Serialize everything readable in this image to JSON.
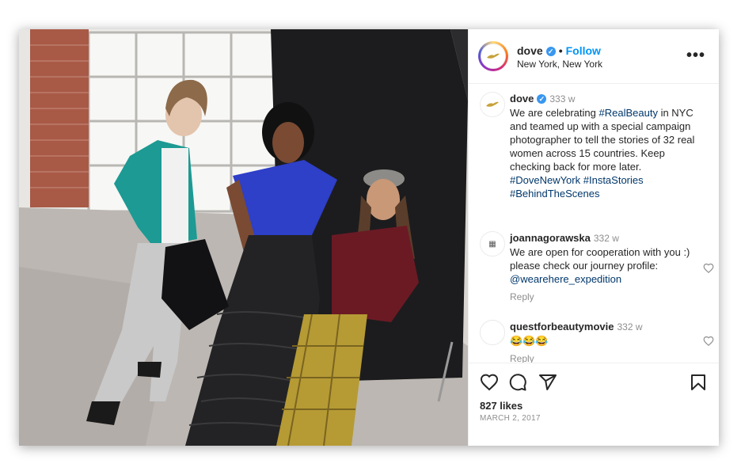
{
  "post": {
    "username": "dove",
    "follow_label": "Follow",
    "separator": "•",
    "location": "New York, New York",
    "more_label": "•••"
  },
  "caption": {
    "username": "dove",
    "time": "333 w",
    "text_1": "We are celebrating ",
    "hashtag_1": "#RealBeauty",
    "text_2": " in NYC and teamed up with a special campaign photographer to tell the stories of 32 real women across 15 countries. Keep checking back for more later. ",
    "hashtag_2": "#DoveNewYork",
    "hashtag_3": "#InstaStories",
    "hashtag_4": "#BehindTheScenes"
  },
  "comments": [
    {
      "username": "joannagorawska",
      "time": "332 w",
      "text": "We are open for cooperation with you :) please check our journey profile: ",
      "mention": "@wearehere_expedition",
      "reply_label": "Reply"
    },
    {
      "username": "questforbeautymovie",
      "time": "332 w",
      "text": "😂😂😂",
      "reply_label": "Reply"
    }
  ],
  "stats": {
    "likes": "827 likes",
    "date": "MARCH 2, 2017"
  },
  "icons": {
    "like": "heart-icon",
    "comment": "comment-icon",
    "share": "send-icon",
    "save": "bookmark-icon",
    "verified": "verified-badge-icon"
  },
  "colors": {
    "link": "#0095f6",
    "hashtag": "#00376b",
    "verified": "#3897f0"
  }
}
